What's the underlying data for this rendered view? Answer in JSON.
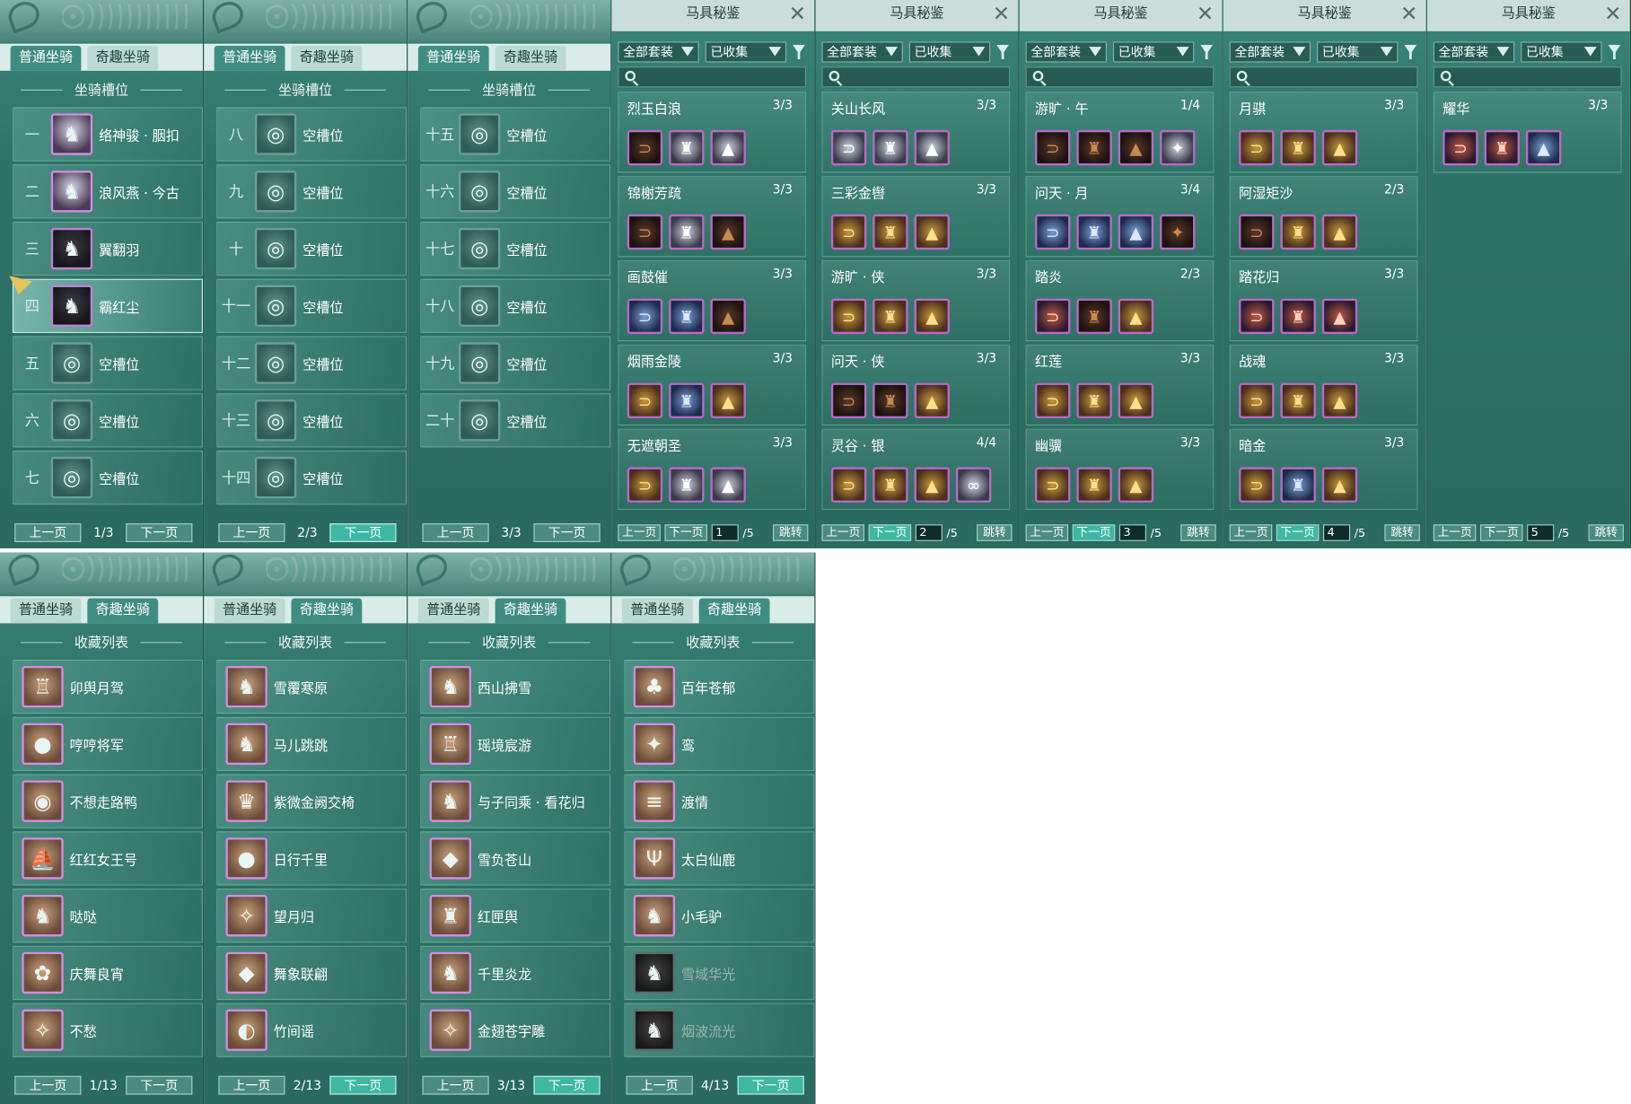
{
  "tabs": {
    "normal": "普通坐骑",
    "fun": "奇趣坐骑"
  },
  "slot_header": "坐骑槽位",
  "collection_header": "收藏列表",
  "buttons": {
    "prev": "上一页",
    "next": "下一页"
  },
  "slot_pages": [
    {
      "page": "1/3",
      "rows": [
        {
          "num": "一",
          "name": "络神骏 · 胭扣",
          "filled": true
        },
        {
          "num": "二",
          "name": "浪风燕 · 今古",
          "filled": true
        },
        {
          "num": "三",
          "name": "翼翻羽",
          "filled": true
        },
        {
          "num": "四",
          "name": "霸红尘",
          "filled": true,
          "selected": true
        },
        {
          "num": "五",
          "name": "空槽位",
          "filled": false
        },
        {
          "num": "六",
          "name": "空槽位",
          "filled": false
        },
        {
          "num": "七",
          "name": "空槽位",
          "filled": false
        }
      ]
    },
    {
      "page": "2/3",
      "rows": [
        {
          "num": "八",
          "name": "空槽位"
        },
        {
          "num": "九",
          "name": "空槽位"
        },
        {
          "num": "十",
          "name": "空槽位"
        },
        {
          "num": "十一",
          "name": "空槽位"
        },
        {
          "num": "十二",
          "name": "空槽位"
        },
        {
          "num": "十三",
          "name": "空槽位"
        },
        {
          "num": "十四",
          "name": "空槽位"
        }
      ]
    },
    {
      "page": "3/3",
      "rows": [
        {
          "num": "十五",
          "name": "空槽位"
        },
        {
          "num": "十六",
          "name": "空槽位"
        },
        {
          "num": "十七",
          "name": "空槽位"
        },
        {
          "num": "十八",
          "name": "空槽位"
        },
        {
          "num": "十九",
          "name": "空槽位"
        },
        {
          "num": "二十",
          "name": "空槽位"
        }
      ]
    }
  ],
  "codex": {
    "title": "马具秘鉴",
    "filter_all": "全部套装",
    "filter_collected": "已收集",
    "jump": "跳转",
    "total": "/5",
    "pages": [
      {
        "page": "1",
        "sets": [
          {
            "name": "烈玉白浪",
            "count": "3/3"
          },
          {
            "name": "锦榭芳疏",
            "count": "3/3"
          },
          {
            "name": "画鼓催",
            "count": "3/3"
          },
          {
            "name": "烟雨金陵",
            "count": "3/3"
          },
          {
            "name": "无遮朝圣",
            "count": "3/3"
          }
        ]
      },
      {
        "page": "2",
        "sets": [
          {
            "name": "关山长风",
            "count": "3/3"
          },
          {
            "name": "三彩金辔",
            "count": "3/3"
          },
          {
            "name": "游旷 · 侠",
            "count": "3/3"
          },
          {
            "name": "问天 · 侠",
            "count": "3/3"
          },
          {
            "name": "灵谷 · 银",
            "count": "4/4"
          }
        ]
      },
      {
        "page": "3",
        "sets": [
          {
            "name": "游旷 · 午",
            "count": "1/4"
          },
          {
            "name": "问天 · 月",
            "count": "3/4"
          },
          {
            "name": "踏炎",
            "count": "2/3"
          },
          {
            "name": "红莲",
            "count": "3/3"
          },
          {
            "name": "幽骥",
            "count": "3/3"
          }
        ]
      },
      {
        "page": "4",
        "sets": [
          {
            "name": "月骐",
            "count": "3/3"
          },
          {
            "name": "阿湿矩沙",
            "count": "2/3"
          },
          {
            "name": "踏花归",
            "count": "3/3"
          },
          {
            "name": "战魂",
            "count": "3/3"
          },
          {
            "name": "暗金",
            "count": "3/3"
          }
        ]
      },
      {
        "page": "5",
        "sets": [
          {
            "name": "耀华",
            "count": "3/3"
          }
        ]
      }
    ]
  },
  "collection_pages": [
    {
      "page": "1/13",
      "items": [
        "卯舆月驾",
        "哼哼将军",
        "不想走路鸭",
        "红红女王号",
        "哒哒",
        "庆舞良宵",
        "不愁"
      ]
    },
    {
      "page": "2/13",
      "items": [
        "雪覆寒原",
        "马儿跳跳",
        "紫微金阙交椅",
        "日行千里",
        "望月归",
        "舞象联翩",
        "竹间谣"
      ]
    },
    {
      "page": "3/13",
      "items": [
        "西山拂雪",
        "瑶境宸游",
        "与子同乘 · 看花归",
        "雪负苍山",
        "红匣舆",
        "千里炎龙",
        "金翅苍宇雕"
      ]
    },
    {
      "page": "4/13",
      "items": [
        "百年苍郁",
        "鸾",
        "渡情",
        "太白仙鹿",
        "小毛驴",
        "雪域华光",
        "烟波流光"
      ]
    }
  ],
  "colors": {
    "panel": "#2f7367",
    "accent": "#3fb8a3",
    "tab_bg": "#d9ece8",
    "title_bg": "#c9dedb",
    "rarity_border": "#b86ac9"
  }
}
